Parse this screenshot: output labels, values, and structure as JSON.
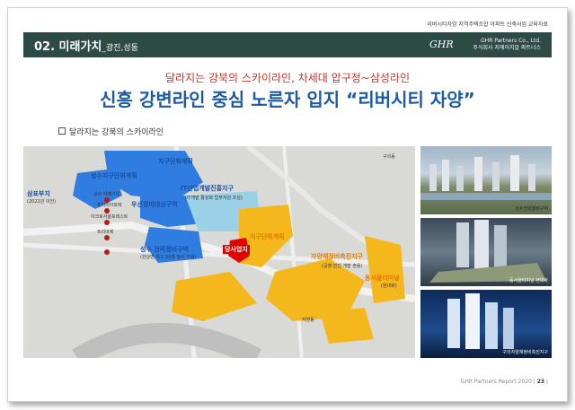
{
  "page": {
    "top_note": "리버시티자양 지역주택조합 아파트 신축사업 교육자료",
    "header": {
      "title": "02. 미래가치",
      "title_sub": "_광진,성동",
      "logo": "GHR",
      "company_en": "GHR Partners Co., Ltd.",
      "company_kr": "주식회사 지에이치알 파트너스"
    },
    "subtitle": "달라지는 강북의 스카이라인, 차세대 압구정~삼성라인",
    "main_title": "신흥 강변라인 중심 노른자 입지 “리버시티 자양”",
    "section_label": "달라지는 강북의 스카이라인",
    "footer": {
      "text": "GHR Partners Report 2020",
      "page": "23"
    }
  },
  "map": {
    "labels": {
      "jigu_top": "지구단위계획",
      "seongsu_jigu": "성수지구단위계획",
      "it_district": "IT산업개발진흥지구",
      "it_sub": "(IT개발 활성화 업무지원 조성)",
      "woosun": "우선정비대상구역",
      "sampyo": "삼표부지",
      "sampyo_sub": "(2022년 이전)",
      "seongsu_cafe": "성수 카페거리",
      "galleria": "갤러리아포레",
      "triumph": "트리마제",
      "acro": "아크로서울포레스트",
      "seongsu_strat": "성수 전략정비구역",
      "seongsu_strat_sub": "(한강변 최고 50층 높이 허용)",
      "jigu_mid": "지구단위계획",
      "site": "당사업지",
      "jayang": "자양재정비촉진지구",
      "jayang_sub": "(공영·민간 개발 혼용)",
      "east_seoul": "동서울터미널",
      "east_seoul_sub": "(현대화)",
      "gui": "구의동",
      "jayang_dong": "자양동"
    }
  },
  "photos": [
    {
      "caption": "성수전략정비구역"
    },
    {
      "caption": "동서울터미널 현대화"
    },
    {
      "caption": "구의자양재정비촉진지구"
    }
  ]
}
